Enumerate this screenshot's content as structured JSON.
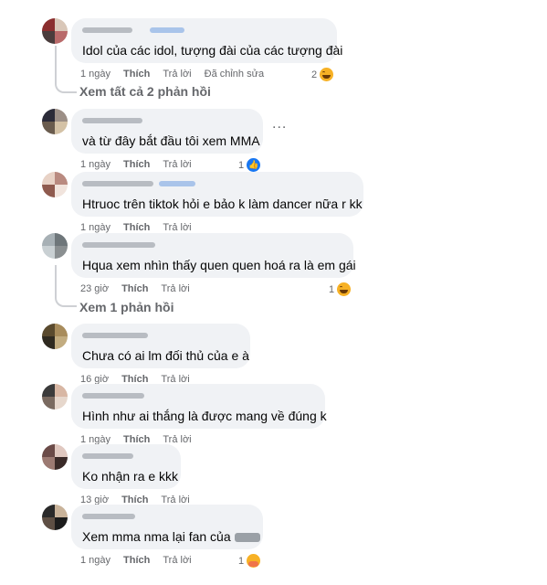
{
  "comments": [
    {
      "text": "Idol của các idol, tượng đài của các tượng đài",
      "time": "1 ngày",
      "like": "Thích",
      "reply": "Trả lời",
      "edited": "Đã chỉnh sửa",
      "reaction_count": "2",
      "reaction_icon": "haha-icon",
      "avatar_colors": [
        "#8b2e2e",
        "#d9c7b8",
        "#4a3c3c",
        "#b96a6a"
      ],
      "view_replies": "Xem tất cả 2 phản hồi"
    },
    {
      "text": "và từ đây bắt đầu tôi xem MMA",
      "time": "1 ngày",
      "like": "Thích",
      "reply": "Trả lời",
      "reaction_count": "1",
      "reaction_icon": "like-icon",
      "avatar_colors": [
        "#2b2b38",
        "#9c8f86",
        "#6a5c4e",
        "#d4c2a6"
      ],
      "more": "..."
    },
    {
      "text": "Htruoc trên tiktok hỏi e bảo k làm dancer nữa r kk",
      "time": "1 ngày",
      "like": "Thích",
      "reply": "Trả lời",
      "avatar_colors": [
        "#e8d2c6",
        "#b98a80",
        "#8f5a4e",
        "#f1e4dd"
      ]
    },
    {
      "text": "Hqua xem nhìn thấy quen quen hoá ra là em gái",
      "time": "23 giờ",
      "like": "Thích",
      "reply": "Trả lời",
      "reaction_count": "1",
      "reaction_icon": "haha-icon",
      "avatar_colors": [
        "#a7b0b5",
        "#6e767a",
        "#c9d0d3",
        "#8a8f91"
      ],
      "view_replies": "Xem 1 phản hồi"
    },
    {
      "text": "Chưa có ai lm đối thủ của e à",
      "time": "16 giờ",
      "like": "Thích",
      "reply": "Trả lời",
      "avatar_colors": [
        "#5a4a2e",
        "#a88c5c",
        "#2f2a20",
        "#c2ac80"
      ]
    },
    {
      "text": "Hình như ai thắng là được mang về đúng k",
      "time": "1 ngày",
      "like": "Thích",
      "reply": "Trả lời",
      "avatar_colors": [
        "#3b3b3b",
        "#d8b7a4",
        "#7a6a60",
        "#e6d7cc"
      ]
    },
    {
      "text": "Ko nhận ra e kkk",
      "time": "13 giờ",
      "like": "Thích",
      "reply": "Trả lời",
      "avatar_colors": [
        "#6b4b48",
        "#e0c8c0",
        "#9c7a72",
        "#3a2a28"
      ]
    },
    {
      "text": "Xem mma nma lại fan của",
      "time": "1 ngày",
      "like": "Thích",
      "reply": "Trả lời",
      "reaction_count": "1",
      "reaction_icon": "care-icon",
      "avatar_colors": [
        "#2a2a2a",
        "#c9b39a",
        "#5e4f44",
        "#1c1c1c"
      ]
    }
  ],
  "colors": {
    "bubble": "#f0f2f5",
    "meta": "#65676b",
    "like_blue": "#1877f2",
    "line": "#ced0d4"
  }
}
